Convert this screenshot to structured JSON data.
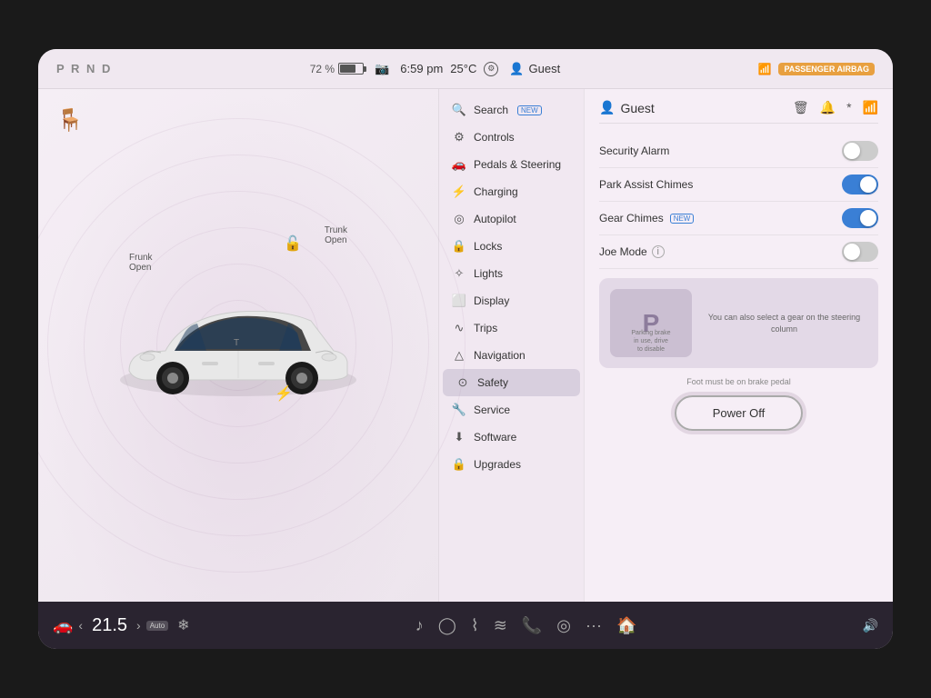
{
  "status_bar": {
    "prnd": "P R N D",
    "battery_pct": "72 %",
    "time": "6:59 pm",
    "temp": "25°C",
    "user": "Guest",
    "airbag": "PASSENGER AIRBAG"
  },
  "car_labels": {
    "frunk": "Frunk\nOpen",
    "trunk": "Trunk\nOpen"
  },
  "menu": {
    "search": "Search",
    "search_badge": "NEW",
    "items": [
      {
        "id": "controls",
        "label": "Controls",
        "icon": "⚙"
      },
      {
        "id": "pedals",
        "label": "Pedals & Steering",
        "icon": "🚗"
      },
      {
        "id": "charging",
        "label": "Charging",
        "icon": "⚡"
      },
      {
        "id": "autopilot",
        "label": "Autopilot",
        "icon": "◎"
      },
      {
        "id": "locks",
        "label": "Locks",
        "icon": "🔒"
      },
      {
        "id": "lights",
        "label": "Lights",
        "icon": "✧"
      },
      {
        "id": "display",
        "label": "Display",
        "icon": "⬜"
      },
      {
        "id": "trips",
        "label": "Trips",
        "icon": "∿"
      },
      {
        "id": "navigation",
        "label": "Navigation",
        "icon": "△"
      },
      {
        "id": "safety",
        "label": "Safety",
        "icon": "⊙",
        "active": true
      },
      {
        "id": "service",
        "label": "Service",
        "icon": "🔧"
      },
      {
        "id": "software",
        "label": "Software",
        "icon": "⬇"
      },
      {
        "id": "upgrades",
        "label": "Upgrades",
        "icon": "🔒"
      }
    ]
  },
  "settings": {
    "user_title": "Guest",
    "toggles": [
      {
        "id": "security_alarm",
        "label": "Security Alarm",
        "state": "off"
      },
      {
        "id": "park_assist",
        "label": "Park Assist Chimes",
        "state": "on"
      },
      {
        "id": "gear_chimes",
        "label": "Gear Chimes",
        "badge": "NEW",
        "state": "on"
      },
      {
        "id": "joe_mode",
        "label": "Joe Mode",
        "info": true,
        "state": "off"
      }
    ],
    "park_card": {
      "p_letter": "P",
      "main_text": "Parking brake\nin use, drive\nto disable",
      "steering_text": "You can also select a gear on the steering column",
      "foot_text": "Foot must be on brake pedal"
    },
    "power_off_label": "Power Off"
  },
  "taskbar": {
    "odometer": "21.5",
    "auto_label": "Auto",
    "icons": [
      "🚗",
      "♪",
      "◯",
      "⌇",
      "≋",
      "📞",
      "◎",
      "···",
      "🏠",
      "🔊"
    ]
  }
}
